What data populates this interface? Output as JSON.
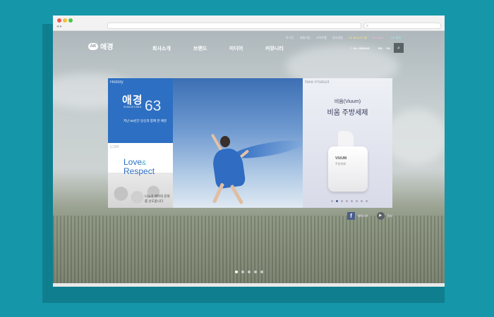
{
  "header": {
    "logo_badge": "AK",
    "logo_text": "애경",
    "util_links": [
      {
        "label": "로그인",
        "color": "#eeeeff"
      },
      {
        "label": "회원가입",
        "color": "#eeeeff"
      },
      {
        "label": "사이트맵",
        "color": "#eeeeff"
      },
      {
        "label": "윤리경영",
        "color": "#eeeeff"
      },
      {
        "label": "AK BEAUTY몰",
        "color": "#ffe07a"
      },
      {
        "label": "AK MALL",
        "color": "#f3b5d2"
      },
      {
        "label": "AK 면세",
        "color": "#9ee8f0"
      }
    ],
    "menu": [
      "회사소개",
      "브랜드",
      "미디어",
      "커뮤니티"
    ],
    "all_brand": "ALL BRAND",
    "lang": [
      "EN",
      "CN"
    ],
    "search_icon": "search-icon"
  },
  "cards": {
    "history": {
      "tag": "History",
      "big": "애경",
      "since": "SINCE1954",
      "num": "63",
      "desc": "지난 63년간 당신과 함께 한 애경"
    },
    "csr": {
      "tag": "CSR",
      "line1_a": "Love",
      "amp": "&",
      "line2": "Respect",
      "desc": "나눔과 배려의 문화를 선도합니다"
    },
    "product": {
      "tag": "New Product",
      "name": "비움(Viuum)",
      "title": "비움 주방세제",
      "bottle_brand": "VIUUM",
      "bottle_sub": "주방세제",
      "slide_count": 8,
      "active_slide": 1
    }
  },
  "social": {
    "facebook_label": "페이스북",
    "play_label": "정지"
  },
  "hero": {
    "slide_count": 5,
    "active_slide": 0
  },
  "colors": {
    "page_bg": "#1596a9",
    "accent_blue": "#2d6fc2",
    "search_btn": "#5a6266"
  }
}
